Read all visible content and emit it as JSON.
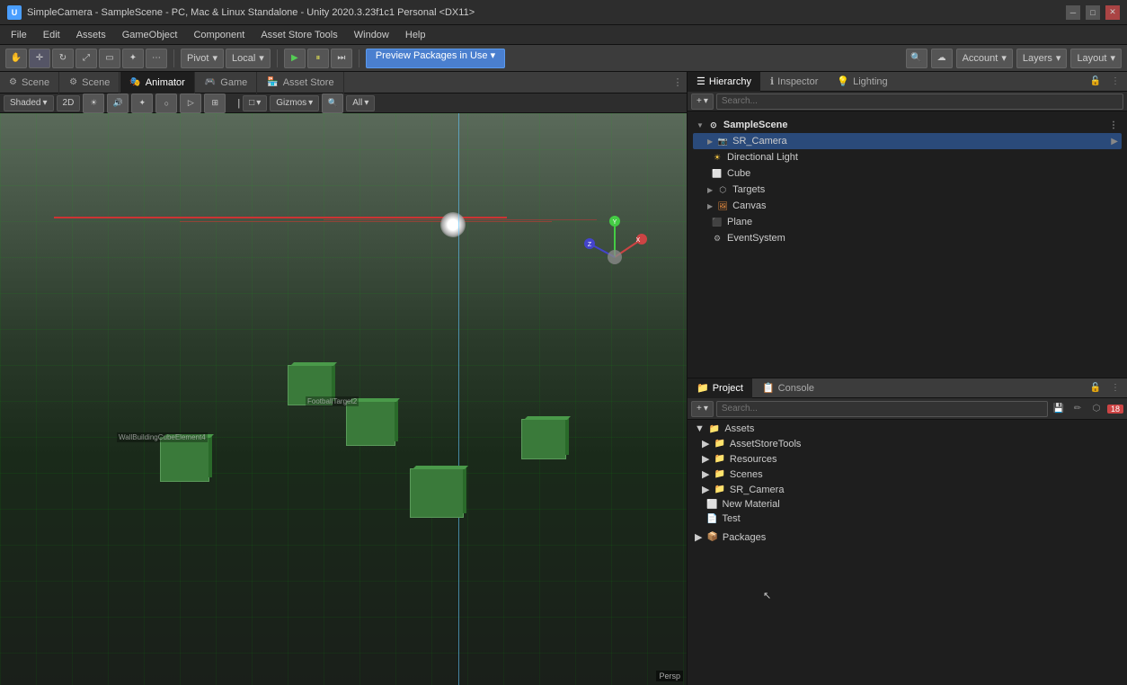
{
  "window": {
    "title": "SimpleCamera - SampleScene - PC, Mac & Linux Standalone - Unity 2020.3.23f1c1 Personal <DX11>"
  },
  "menu": {
    "items": [
      "File",
      "Edit",
      "Assets",
      "GameObject",
      "Component",
      "Asset Store Tools",
      "Window",
      "Help"
    ]
  },
  "toolbar": {
    "pivot_label": "Pivot",
    "local_label": "Local",
    "preview_packages_label": "Preview Packages in Use",
    "account_label": "Account",
    "layers_label": "Layers",
    "layout_label": "Layout",
    "play_btn": "▶",
    "pause_btn": "⏸",
    "step_btn": "⏭"
  },
  "scene_view": {
    "shading_mode": "Shaded",
    "dimension": "2D",
    "gizmos_label": "Gizmos",
    "search_placeholder": "All",
    "persp_label": "Persp",
    "tabs": [
      "Scene",
      "Scene",
      "Animator",
      "Game",
      "Asset Store"
    ]
  },
  "hierarchy": {
    "title": "Hierarchy",
    "scene_name": "SampleScene",
    "search_placeholder": "Search...",
    "items": [
      {
        "name": "SampleScene",
        "type": "scene",
        "depth": 0
      },
      {
        "name": "SR_Camera",
        "type": "camera",
        "depth": 1,
        "selected": true
      },
      {
        "name": "Directional Light",
        "type": "light",
        "depth": 1
      },
      {
        "name": "Cube",
        "type": "cube",
        "depth": 1
      },
      {
        "name": "Targets",
        "type": "generic",
        "depth": 1
      },
      {
        "name": "Canvas",
        "type": "canvas",
        "depth": 1
      },
      {
        "name": "Plane",
        "type": "cube",
        "depth": 1
      },
      {
        "name": "EventSystem",
        "type": "generic",
        "depth": 1
      }
    ]
  },
  "inspector": {
    "title": "Inspector"
  },
  "lighting": {
    "title": "Lighting"
  },
  "project": {
    "title": "Project",
    "toolbar_add": "+",
    "search_placeholder": "Search...",
    "badge_count": "18",
    "assets": {
      "root": "Assets",
      "folders": [
        {
          "name": "AssetStoreTools",
          "depth": 1
        },
        {
          "name": "Resources",
          "depth": 1
        },
        {
          "name": "Scenes",
          "depth": 1
        },
        {
          "name": "SR_Camera",
          "depth": 1
        },
        {
          "name": "New Material",
          "depth": 1,
          "type": "file"
        },
        {
          "name": "Test",
          "depth": 1,
          "type": "file"
        }
      ],
      "packages_root": "Packages"
    }
  },
  "console": {
    "title": "Console"
  },
  "status_bar": {
    "message": ""
  }
}
